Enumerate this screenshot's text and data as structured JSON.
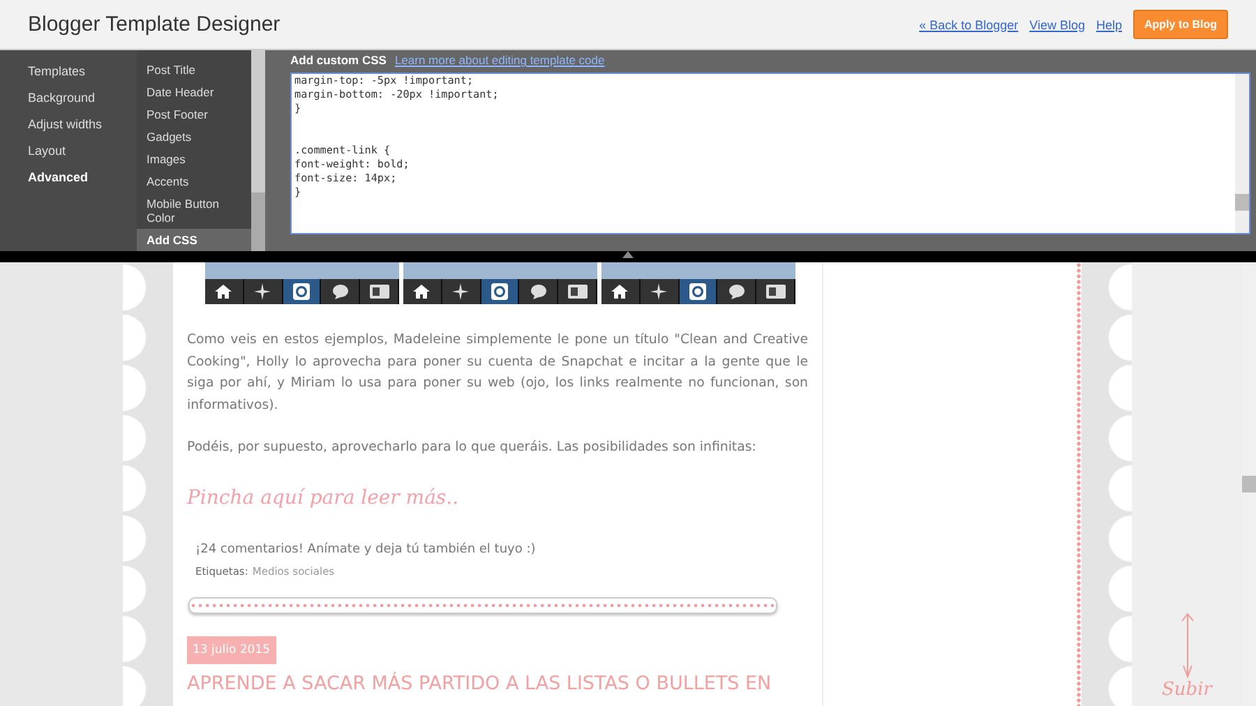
{
  "header": {
    "title": "Blogger Template Designer",
    "links": [
      "« Back to Blogger",
      "View Blog",
      "Help"
    ],
    "apply_button": "Apply to Blog"
  },
  "nav": {
    "items": [
      {
        "label": "Templates",
        "selected": false
      },
      {
        "label": "Background",
        "selected": false
      },
      {
        "label": "Adjust widths",
        "selected": false
      },
      {
        "label": "Layout",
        "selected": false
      },
      {
        "label": "Advanced",
        "selected": true
      }
    ]
  },
  "subnav": {
    "items": [
      {
        "label": "Post Title",
        "selected": false
      },
      {
        "label": "Date Header",
        "selected": false
      },
      {
        "label": "Post Footer",
        "selected": false
      },
      {
        "label": "Gadgets",
        "selected": false
      },
      {
        "label": "Images",
        "selected": false
      },
      {
        "label": "Accents",
        "selected": false
      },
      {
        "label": "Mobile Button Color",
        "selected": false
      },
      {
        "label": "Add CSS",
        "selected": true
      }
    ]
  },
  "css_editor": {
    "label": "Add custom CSS",
    "help_link": "Learn more about editing template code",
    "code_blocks": [
      [
        "margin-top: -5px !important;",
        "margin-bottom: -20px !important;",
        "}"
      ],
      [
        ".comment-link {",
        "font-weight: bold;",
        "font-size: 14px;",
        "}"
      ]
    ]
  },
  "post": {
    "thumbnails": [
      {
        "tools": [
          {
            "selected": false
          },
          {
            "selected": false
          },
          {
            "selected": true
          },
          {
            "selected": false
          },
          {
            "selected": false
          }
        ]
      },
      {
        "tools": [
          {
            "selected": false
          },
          {
            "selected": false
          },
          {
            "selected": true
          },
          {
            "selected": false
          },
          {
            "selected": false
          }
        ]
      },
      {
        "tools": [
          {
            "selected": false
          },
          {
            "selected": false
          },
          {
            "selected": true
          },
          {
            "selected": false
          },
          {
            "selected": false
          }
        ]
      }
    ],
    "paragraphs": [
      "Como veis en estos ejemplos, Madeleine simplemente le pone un título \"Clean and Creative Cooking\", Holly lo aprovecha para poner su cuenta de Snapchat e incitar a la gente que le siga por ahí, y Miriam lo usa para poner su web (ojo, los links realmente no funcionan, son informativos).",
      "Podéis, por supuesto, aprovecharlo para lo que queráis. Las posibilidades son infinitas:"
    ],
    "read_more": "Pincha aquí para leer más..",
    "comments": "¡24 comentarios! Anímate y deja tú también el tuyo :)",
    "labels_caption": "Etiquetas:",
    "label_link": "Medios sociales"
  },
  "next_post": {
    "date": "13 julio 2015",
    "title": "APRENDE A SACAR MÁS PARTIDO A LAS LISTAS O BULLETS EN"
  },
  "back_to_top": "Subir"
}
